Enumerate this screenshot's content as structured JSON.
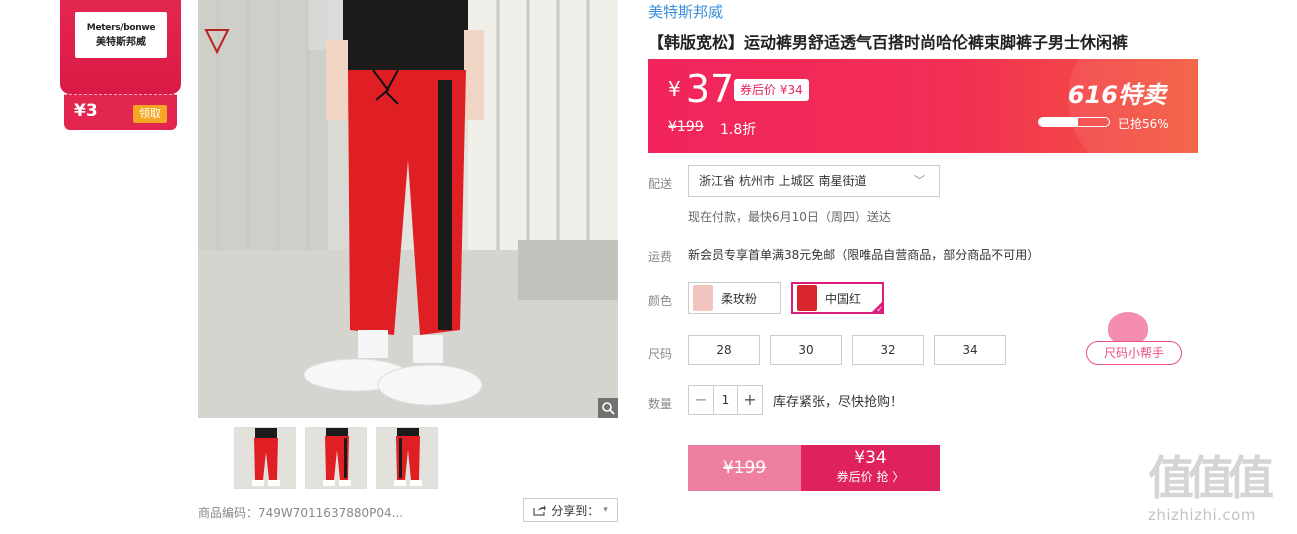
{
  "coupon": {
    "brand_line1": "Meters/bonwe",
    "brand_line2": "美特斯邦威",
    "amount": "¥3",
    "claim_label": "领取"
  },
  "gallery": {
    "sku_text": "商品编码：749W7011637880P04...",
    "share_label": "分享到：",
    "thumbnail_count": 3
  },
  "product": {
    "brand": "美特斯邦威",
    "title": "【韩版宽松】运动裤男舒适透气百搭时尚哈伦裤束脚裤子男士休闲裤"
  },
  "price": {
    "currency": "¥",
    "value": "37",
    "after_coupon": "券后价 ¥34",
    "original": "¥199",
    "discount": "1.8折",
    "sale_name": "616特卖",
    "sold_percent": 56,
    "sold_text": "已抢56%"
  },
  "delivery": {
    "label": "配送",
    "address": "浙江省 杭州市 上城区 南星街道",
    "ship_note": "现在付款，最快6月10日（周四）送达"
  },
  "freight": {
    "label": "运费",
    "text": "新会员专享首单满38元免邮（限唯品自营商品，部分商品不可用）"
  },
  "colors": {
    "label": "颜色",
    "options": [
      {
        "name": "柔玫粉",
        "swatch": "#f2c4c0"
      },
      {
        "name": "中国红",
        "swatch": "#d8252b"
      }
    ],
    "selected": "中国红"
  },
  "sizes": {
    "label": "尺码",
    "options": [
      "28",
      "30",
      "32",
      "34"
    ]
  },
  "size_helper": {
    "label": "尺码小帮手"
  },
  "quantity": {
    "label": "数量",
    "value": "1",
    "minus": "−",
    "plus": "+",
    "stock_note": "库存紧张，尽快抢购！"
  },
  "buy": {
    "original": "¥199",
    "price": "¥34",
    "action": "券后价 抢 〉"
  },
  "watermark": {
    "chars": "值值值",
    "url": "zhizhizhi.com"
  },
  "colors_theme": {
    "accent": "#e3264f",
    "link": "#3b8fd9",
    "selected": "#d81e7a"
  }
}
